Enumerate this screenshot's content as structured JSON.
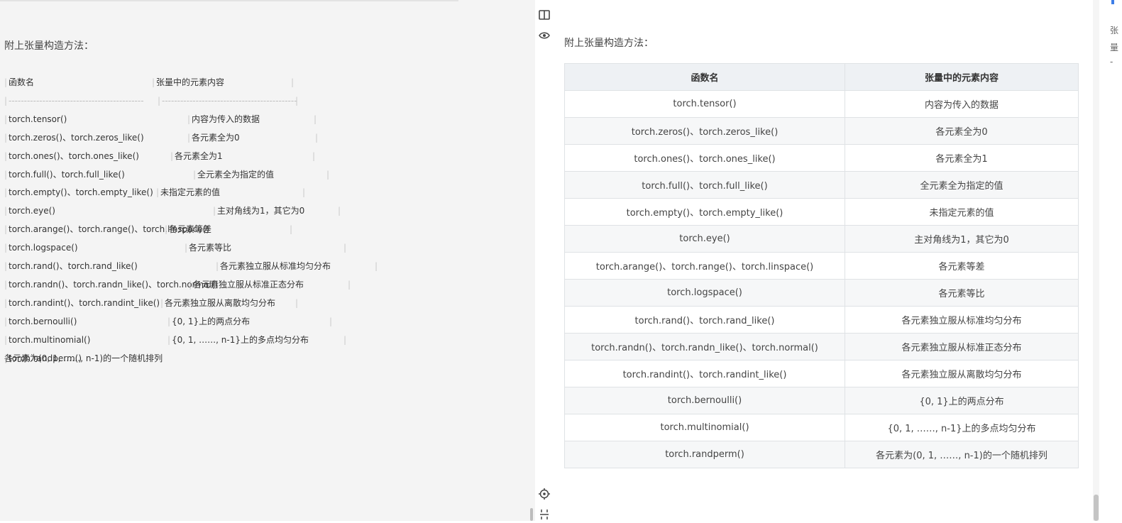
{
  "editor": {
    "heading": "附上张量构造方法：",
    "header_row": [
      "函数名",
      "张量中的元素内容"
    ],
    "separator_left": "--------------------------------------------",
    "separator_right": "--------------------------------------------",
    "rows": [
      [
        "torch.tensor()",
        "内容为传入的数据"
      ],
      [
        "torch.zeros()、torch.zeros_like()",
        "各元素全为0"
      ],
      [
        "torch.ones()、torch.ones_like()",
        "各元素全为1"
      ],
      [
        "torch.full()、torch.full_like()",
        "全元素全为指定的值"
      ],
      [
        "torch.empty()、torch.empty_like()",
        "未指定元素的值"
      ],
      [
        "torch.eye()",
        "主对角线为1，其它为0"
      ],
      [
        "torch.arange()、torch.range()、torch.linspace()",
        "各元素等差"
      ],
      [
        "torch.logspace()",
        "各元素等比"
      ],
      [
        "torch.rand()、torch.rand_like()",
        "各元素独立服从标准均匀分布"
      ],
      [
        "torch.randn()、torch.randn_like()、torch.normal()",
        "各元素独立服从标准正态分布"
      ],
      [
        "torch.randint()、torch.randint_like()",
        "各元素独立服从离散均匀分布"
      ],
      [
        "torch.bernoulli()",
        "{0, 1}上的两点分布"
      ],
      [
        "torch.multinomial()",
        "{0, 1, ……, n-1}上的多点均匀分布"
      ],
      [
        "torch.randperm()",
        "各元素为(0, 1, ……, n-1)的一个随机排列"
      ]
    ]
  },
  "gutter": {
    "icons": [
      "split-view-icon",
      "eye-icon",
      "crosshair-icon",
      "align-icon"
    ]
  },
  "preview": {
    "heading": "附上张量构造方法：",
    "table": {
      "headers": [
        "函数名",
        "张量中的元素内容"
      ],
      "rows": [
        [
          "torch.tensor()",
          "内容为传入的数据"
        ],
        [
          "torch.zeros()、torch.zeros_like()",
          "各元素全为0"
        ],
        [
          "torch.ones()、torch.ones_like()",
          "各元素全为1"
        ],
        [
          "torch.full()、torch.full_like()",
          "全元素全为指定的值"
        ],
        [
          "torch.empty()、torch.empty_like()",
          "未指定元素的值"
        ],
        [
          "torch.eye()",
          "主对角线为1，其它为0"
        ],
        [
          "torch.arange()、torch.range()、torch.linspace()",
          "各元素等差"
        ],
        [
          "torch.logspace()",
          "各元素等比"
        ],
        [
          "torch.rand()、torch.rand_like()",
          "各元素独立服从标准均匀分布"
        ],
        [
          "torch.randn()、torch.randn_like()、torch.normal()",
          "各元素独立服从标准正态分布"
        ],
        [
          "torch.randint()、torch.randint_like()",
          "各元素独立服从离散均匀分布"
        ],
        [
          "torch.bernoulli()",
          "{0, 1}上的两点分布"
        ],
        [
          "torch.multinomial()",
          "{0, 1, ……, n-1}上的多点均匀分布"
        ],
        [
          "torch.randperm()",
          "各元素为(0, 1, ……, n-1)的一个随机排列"
        ]
      ]
    }
  },
  "right_strip": {
    "edge_texts": [
      "张",
      "量",
      "-"
    ]
  }
}
